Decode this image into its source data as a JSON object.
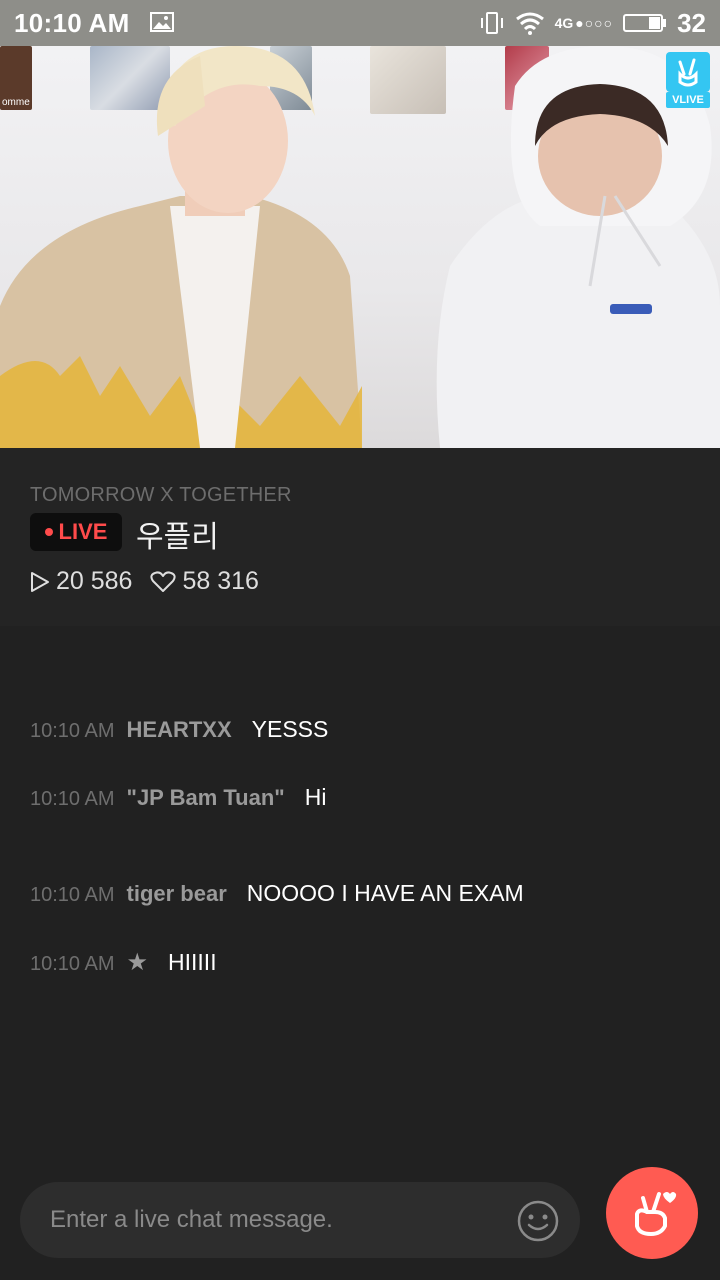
{
  "status_bar": {
    "time": "10:10 AM",
    "network": "4G",
    "battery_level": "32",
    "icons": [
      "image-icon",
      "vibrate-icon",
      "wifi-icon",
      "signal-icon",
      "battery-icon"
    ]
  },
  "video": {
    "watermark_label": "VLIVE",
    "poster_text": "omme"
  },
  "stream": {
    "channel": "TOMORROW X TOGETHER",
    "live_label": "LIVE",
    "title": "우플리",
    "views": "20 586",
    "likes": "58 316"
  },
  "chat": {
    "messages": [
      {
        "time": "10:10 AM",
        "user": "HEARTXX",
        "text": "YESSS"
      },
      {
        "time": "10:10 AM",
        "user": "\"JP Bam Tuan\"",
        "text": "Hi"
      },
      {
        "time": "10:10 AM",
        "user": "tiger bear",
        "text": "NOOOO I HAVE AN EXAM"
      },
      {
        "time": "10:10 AM",
        "user": "★",
        "text": "HIIIII"
      }
    ]
  },
  "input": {
    "placeholder": "Enter a live chat message."
  },
  "colors": {
    "accent": "#ff5b52",
    "live_red": "#ff4b4b",
    "vlive_blue": "#34c6f2",
    "background": "#212121"
  }
}
